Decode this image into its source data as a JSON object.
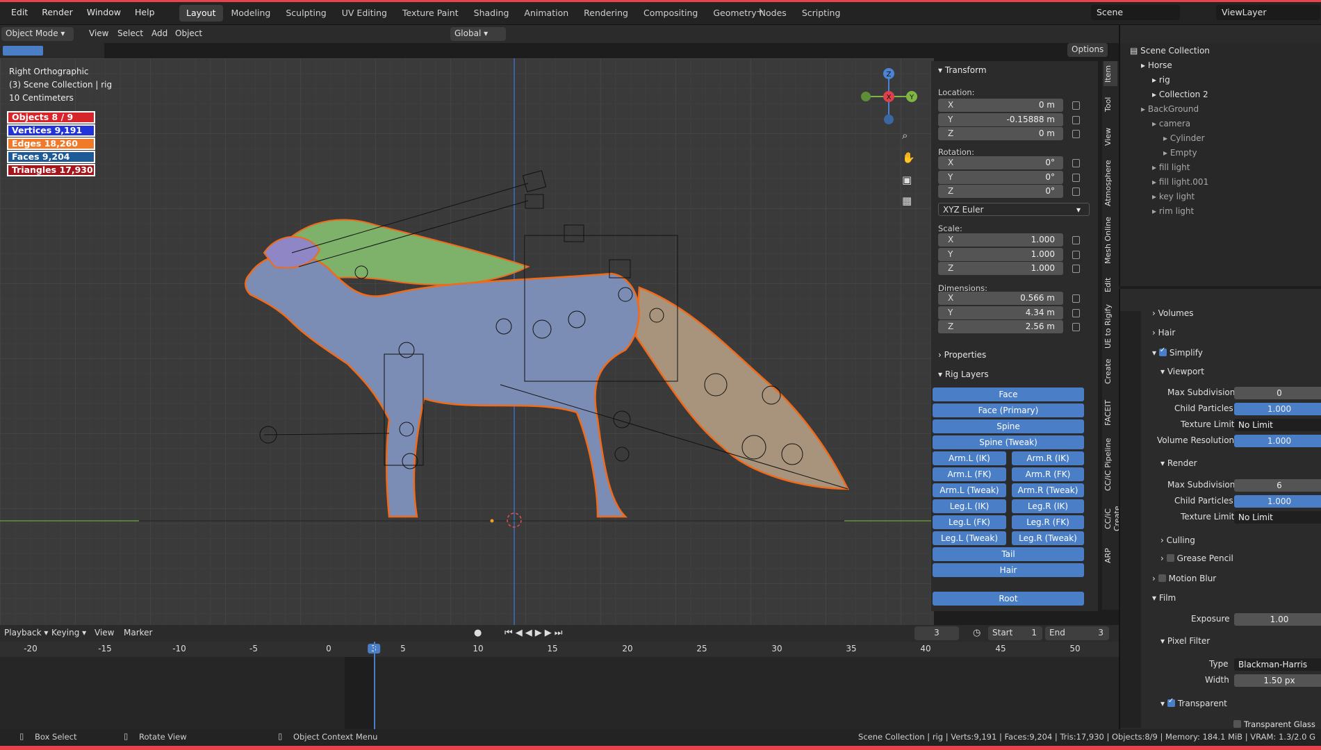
{
  "menu": [
    "Edit",
    "Render",
    "Window",
    "Help"
  ],
  "workspaces": [
    "Layout",
    "Modeling",
    "Sculpting",
    "UV Editing",
    "Texture Paint",
    "Shading",
    "Animation",
    "Rendering",
    "Compositing",
    "Geometry Nodes",
    "Scripting"
  ],
  "scene": "Scene",
  "view_layer": "ViewLayer",
  "header": {
    "mode": "Object Mode",
    "view": "View",
    "select": "Select",
    "add": "Add",
    "object": "Object",
    "orientation": "Global",
    "options": "Options"
  },
  "viewport": {
    "view_name": "Right Orthographic",
    "collection": "(3) Scene Collection | rig",
    "scale": "10 Centimeters",
    "stats": [
      {
        "label": "Objects 8 / 9",
        "color": "#d6262b"
      },
      {
        "label": "Vertices 9,191",
        "color": "#2233d8"
      },
      {
        "label": "Edges 18,260",
        "color": "#f07a2a"
      },
      {
        "label": "Faces 9,204",
        "color": "#1d5a98"
      },
      {
        "label": "Triangles 17,930",
        "color": "#a4161b"
      }
    ],
    "gizmo": {
      "z": "Z",
      "x": "X",
      "y": "Y"
    }
  },
  "transform": {
    "title": "Transform",
    "location": "Location:",
    "rotation": "Rotation:",
    "scale": "Scale:",
    "dimensions": "Dimensions:",
    "rot_mode": "XYZ Euler",
    "loc": [
      {
        "a": "X",
        "v": "0 m"
      },
      {
        "a": "Y",
        "v": "-0.15888 m"
      },
      {
        "a": "Z",
        "v": "0 m"
      }
    ],
    "rot": [
      {
        "a": "X",
        "v": "0°"
      },
      {
        "a": "Y",
        "v": "0°"
      },
      {
        "a": "Z",
        "v": "0°"
      }
    ],
    "scl": [
      {
        "a": "X",
        "v": "1.000"
      },
      {
        "a": "Y",
        "v": "1.000"
      },
      {
        "a": "Z",
        "v": "1.000"
      }
    ],
    "dim": [
      {
        "a": "X",
        "v": "0.566 m"
      },
      {
        "a": "Y",
        "v": "4.34 m"
      },
      {
        "a": "Z",
        "v": "2.56 m"
      }
    ]
  },
  "properties_title": "Properties",
  "rig_layers_title": "Rig Layers",
  "rig_layers": {
    "face": "Face",
    "face_primary": "Face (Primary)",
    "spine": "Spine",
    "spine_tweak": "Spine (Tweak)",
    "pairs": [
      [
        "Arm.L (IK)",
        "Arm.R (IK)"
      ],
      [
        "Arm.L (FK)",
        "Arm.R (FK)"
      ],
      [
        "Arm.L (Tweak)",
        "Arm.R (Tweak)"
      ],
      [
        "Leg.L (IK)",
        "Leg.R (IK)"
      ],
      [
        "Leg.L (FK)",
        "Leg.R (FK)"
      ],
      [
        "Leg.L (Tweak)",
        "Leg.R (Tweak)"
      ]
    ],
    "tail": "Tail",
    "hair": "Hair",
    "root": "Root"
  },
  "side_tabs": [
    "Item",
    "Tool",
    "View",
    "Atmosphere",
    "Mesh Online",
    "Edit",
    "UE to Rigify",
    "Create",
    "FACEIT",
    "CC/iC Pipeline",
    "CC/iC Create",
    "ARP"
  ],
  "outliner": {
    "root": "Scene Collection",
    "items": [
      {
        "name": "Horse",
        "indent": 0
      },
      {
        "name": "rig",
        "indent": 1
      },
      {
        "name": "Collection 2",
        "indent": 1
      },
      {
        "name": "BackGround",
        "indent": 0
      },
      {
        "name": "camera",
        "indent": 1
      },
      {
        "name": "Cylinder",
        "indent": 2
      },
      {
        "name": "Empty",
        "indent": 2
      },
      {
        "name": "fill light",
        "indent": 1
      },
      {
        "name": "fill light.001",
        "indent": 1
      },
      {
        "name": "key light",
        "indent": 1
      },
      {
        "name": "rim light",
        "indent": 1
      }
    ]
  },
  "props": {
    "volumes": "Volumes",
    "hair": "Hair",
    "simplify": "Simplify",
    "viewport": "Viewport",
    "max_sub": "Max Subdivision",
    "child": "Child Particles",
    "tex_limit": "Texture Limit",
    "vol_res": "Volume Resolution",
    "render": "Render",
    "culling": "Culling",
    "grease": "Grease Pencil",
    "motion_blur": "Motion Blur",
    "film": "Film",
    "exposure": "Exposure",
    "pixel_filter": "Pixel Filter",
    "type": "Type",
    "width": "Width",
    "transparent": "Transparent",
    "transparent_glass": "Transparent Glass",
    "vals": {
      "vp_max_sub": "0",
      "vp_child": "1.000",
      "vp_tex": "No Limit",
      "vp_vol": "1.000",
      "r_max_sub": "6",
      "r_child": "1.000",
      "r_tex": "No Limit",
      "exposure": "1.00",
      "type": "Blackman-Harris",
      "width": "1.50 px"
    }
  },
  "timeline": {
    "playback": "Playback",
    "keying": "Keying",
    "view": "View",
    "marker": "Marker",
    "current": "3",
    "start_label": "Start",
    "start": "1",
    "end_label": "End",
    "end": "3",
    "ticks": [
      "-20",
      "-15",
      "-10",
      "-5",
      "0",
      "3",
      "5",
      "10",
      "15",
      "20",
      "25",
      "30",
      "35",
      "40",
      "45",
      "50"
    ]
  },
  "status": {
    "select": "Box Select",
    "rotate": "Rotate View",
    "context": "Object Context Menu",
    "info": "Scene Collection | rig | Verts:9,191 | Faces:9,204 | Tris:17,930 | Objects:8/9 | Memory: 184.1 MiB | VRAM: 1.3/2.0 G"
  }
}
